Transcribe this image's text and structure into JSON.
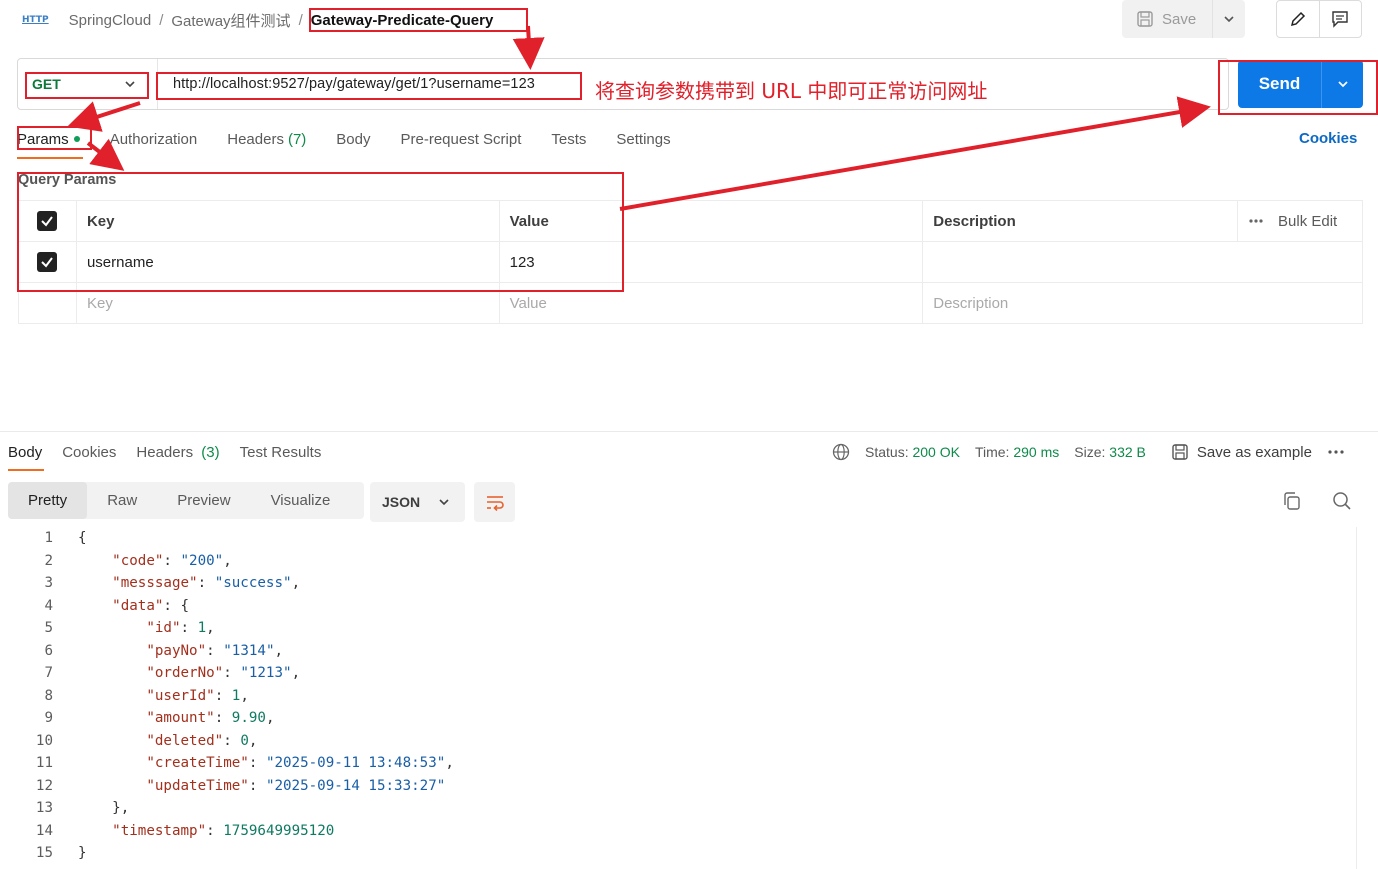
{
  "breadcrumb": {
    "protocol_badge": "HTTP",
    "items": [
      "SpringCloud",
      "Gateway组件测试",
      "Gateway-Predicate-Query"
    ],
    "separator": "/"
  },
  "toolbar": {
    "save_label": "Save"
  },
  "request": {
    "method": "GET",
    "url": "http://localhost:9527/pay/gateway/get/1?username=123",
    "send_label": "Send"
  },
  "annotation": {
    "text": "将查询参数携带到 URL 中即可正常访问网址",
    "color": "#e0202a"
  },
  "request_tabs": [
    {
      "label": "Params",
      "count": ""
    },
    {
      "label": "Authorization",
      "count": ""
    },
    {
      "label": "Headers",
      "count": "(7)"
    },
    {
      "label": "Body",
      "count": ""
    },
    {
      "label": "Pre-request Script",
      "count": ""
    },
    {
      "label": "Tests",
      "count": ""
    },
    {
      "label": "Settings",
      "count": ""
    }
  ],
  "cookies_link": "Cookies",
  "query_params": {
    "title": "Query Params",
    "headers": {
      "key": "Key",
      "value": "Value",
      "description": "Description",
      "bulk_edit": "Bulk Edit"
    },
    "rows": [
      {
        "key": "username",
        "value": "123",
        "description": "",
        "checked": true
      }
    ],
    "placeholders": {
      "key": "Key",
      "value": "Value",
      "description": "Description"
    }
  },
  "response_tabs": [
    {
      "label": "Body",
      "count": ""
    },
    {
      "label": "Cookies",
      "count": ""
    },
    {
      "label": "Headers",
      "count": "(3)"
    },
    {
      "label": "Test Results",
      "count": ""
    }
  ],
  "response_meta": {
    "status_label": "Status:",
    "status": "200 OK",
    "time_label": "Time:",
    "time": "290 ms",
    "size_label": "Size:",
    "size": "332 B",
    "save_example": "Save as example"
  },
  "view_modes": [
    "Pretty",
    "Raw",
    "Preview",
    "Visualize"
  ],
  "format": "JSON",
  "code_lines": [
    {
      "num": "1",
      "indent": "",
      "key": "",
      "value": "",
      "tail": "{"
    },
    {
      "num": "2",
      "indent": "    ",
      "key": "\"code\"",
      "value": "\"200\"",
      "tail": ","
    },
    {
      "num": "3",
      "indent": "    ",
      "key": "\"messsage\"",
      "value": "\"success\"",
      "tail": ","
    },
    {
      "num": "4",
      "indent": "    ",
      "key": "\"data\"",
      "value": "",
      "tail": "{"
    },
    {
      "num": "5",
      "indent": "        ",
      "key": "\"id\"",
      "value": "1",
      "tail": ","
    },
    {
      "num": "6",
      "indent": "        ",
      "key": "\"payNo\"",
      "value": "\"1314\"",
      "tail": ","
    },
    {
      "num": "7",
      "indent": "        ",
      "key": "\"orderNo\"",
      "value": "\"1213\"",
      "tail": ","
    },
    {
      "num": "8",
      "indent": "        ",
      "key": "\"userId\"",
      "value": "1",
      "tail": ","
    },
    {
      "num": "9",
      "indent": "        ",
      "key": "\"amount\"",
      "value": "9.90",
      "tail": ","
    },
    {
      "num": "10",
      "indent": "        ",
      "key": "\"deleted\"",
      "value": "0",
      "tail": ","
    },
    {
      "num": "11",
      "indent": "        ",
      "key": "\"createTime\"",
      "value": "\"2025-09-11 13:48:53\"",
      "tail": ","
    },
    {
      "num": "12",
      "indent": "        ",
      "key": "\"updateTime\"",
      "value": "\"2025-09-14 15:33:27\"",
      "tail": ""
    },
    {
      "num": "13",
      "indent": "    ",
      "key": "",
      "value": "",
      "tail": "},"
    },
    {
      "num": "14",
      "indent": "    ",
      "key": "\"timestamp\"",
      "value": "1759649995120",
      "tail": ""
    },
    {
      "num": "15",
      "indent": "",
      "key": "",
      "value": "",
      "tail": "}"
    }
  ],
  "colors": {
    "send": "#0c79e6",
    "method": "#0b7a3a",
    "accent": "#f06c1f",
    "status_ok": "#0f8a4a"
  },
  "icons": [
    "save-icon",
    "chevron-down-icon",
    "pencil-icon",
    "comment-icon",
    "globe-icon",
    "more-icon",
    "wrap-icon",
    "copy-icon",
    "search-icon"
  ]
}
